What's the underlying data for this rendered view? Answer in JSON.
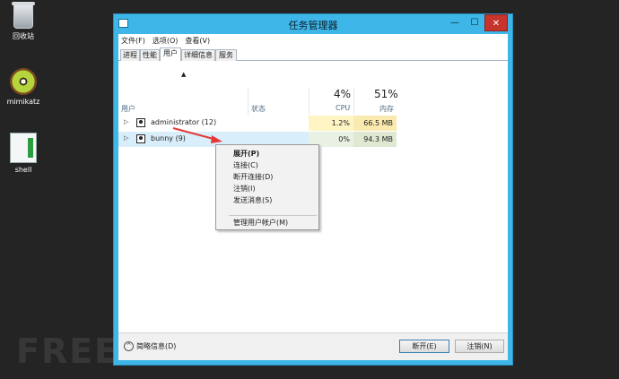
{
  "desktop": {
    "icons": [
      {
        "label": "回收站"
      },
      {
        "label": "mimikatz"
      },
      {
        "label": "shell"
      }
    ],
    "watermark": "FREEBUF"
  },
  "window": {
    "title": "任务管理器",
    "controls": {
      "minimize": "—",
      "maximize": "☐",
      "close": "✕"
    }
  },
  "menubar": [
    "文件(F)",
    "选项(O)",
    "查看(V)"
  ],
  "tabs": [
    {
      "label": "进程",
      "active": false
    },
    {
      "label": "性能",
      "active": false
    },
    {
      "label": "用户",
      "active": true
    },
    {
      "label": "详细信息",
      "active": false
    },
    {
      "label": "服务",
      "active": false
    }
  ],
  "columns": {
    "user": "用户",
    "status": "状态",
    "cpu": {
      "percent": "4%",
      "label": "CPU"
    },
    "memory": {
      "percent": "51%",
      "label": "内存"
    }
  },
  "rows": [
    {
      "name": "administrator (12)",
      "cpu": "1.2%",
      "memory": "66.5 MB"
    },
    {
      "name": "bunny (9)",
      "cpu": "0%",
      "memory": "94.3 MB"
    }
  ],
  "context_menu": {
    "items": [
      "展开(P)",
      "连接(C)",
      "断开连接(D)",
      "注销(I)",
      "发送消息(S)",
      "管理用户帐户(M)"
    ]
  },
  "footer": {
    "fewer_details": "简略信息(D)",
    "disconnect": "断开(E)",
    "logoff": "注销(N)"
  },
  "colors": {
    "window_border": "#3fb6e8",
    "cpu_highlight": "#fff4c4",
    "mem_highlight": "#fbeaaf",
    "arrow": "#e53935"
  }
}
